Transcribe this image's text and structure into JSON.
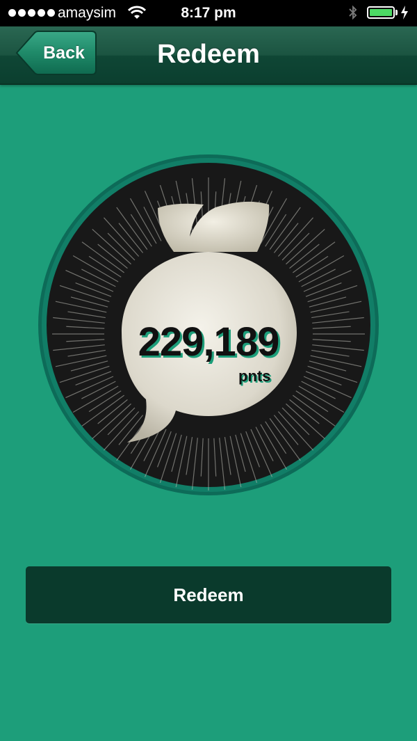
{
  "status_bar": {
    "carrier": "amaysim",
    "time": "8:17 pm",
    "signal_dots": 5,
    "battery_level": 1.0,
    "battery_color": "#4cd964",
    "icons": [
      "signal-dots-icon",
      "wifi-icon",
      "bluetooth-icon",
      "battery-icon",
      "charging-bolt-icon"
    ]
  },
  "nav": {
    "back_label": "Back",
    "title": "Redeem"
  },
  "points": {
    "value": "229,189",
    "unit": "pnts"
  },
  "redeem_button": {
    "label": "Redeem"
  },
  "colors": {
    "background": "#1d9e7a",
    "navbar": "#0f4635",
    "button": "#0a3a2c",
    "badge": "#181818",
    "bubble": "#e4e1d6"
  }
}
